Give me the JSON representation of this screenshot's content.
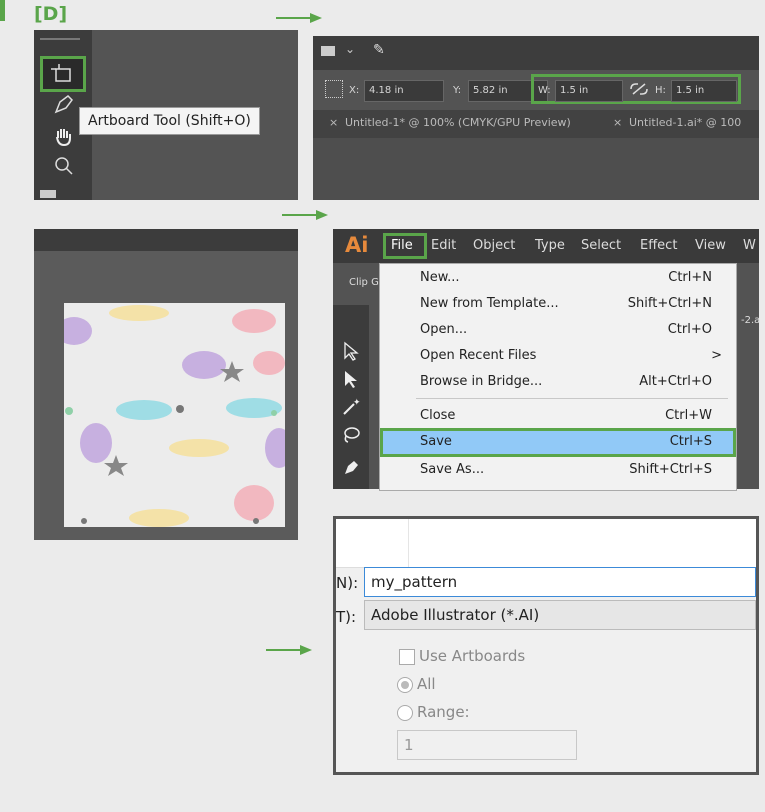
{
  "step_label": "[D]",
  "tooltip": "Artboard Tool (Shift+O)",
  "props": {
    "x_label": "X:",
    "x_value": "4.18 in",
    "y_label": "Y:",
    "y_value": "5.82 in",
    "w_label": "W:",
    "w_value": "1.5 in",
    "h_label": "H:",
    "h_value": "1.5 in"
  },
  "doc_tabs": {
    "tab1": "Untitled-1* @ 100% (CMYK/GPU Preview)",
    "close1": "×",
    "close2": "×",
    "tab2": "Untitled-1.ai* @ 100"
  },
  "menubar": {
    "logo": "Ai",
    "items": [
      "File",
      "Edit",
      "Object",
      "Type",
      "Select",
      "Effect",
      "View",
      "W"
    ],
    "left_label": "Clip G",
    "right_partial": "-2.a"
  },
  "file_menu": [
    {
      "label": "New...",
      "shortcut": "Ctrl+N"
    },
    {
      "label": "New from Template...",
      "shortcut": "Shift+Ctrl+N"
    },
    {
      "label": "Open...",
      "shortcut": "Ctrl+O"
    },
    {
      "label": "Open Recent Files",
      "shortcut": ">"
    },
    {
      "label": "Browse in Bridge...",
      "shortcut": "Alt+Ctrl+O"
    },
    {
      "label": "Close",
      "shortcut": "Ctrl+W"
    },
    {
      "label": "Save",
      "shortcut": "Ctrl+S"
    },
    {
      "label": "Save As...",
      "shortcut": "Shift+Ctrl+S"
    }
  ],
  "save_dialog": {
    "name_label": "N):",
    "name_value": "my_pattern",
    "type_label": "T):",
    "type_value": "Adobe Illustrator (*.AI)",
    "use_artboards": "Use Artboards",
    "all": "All",
    "range": "Range:",
    "range_value": "1"
  },
  "colors": {
    "accent": "#5aa54a",
    "menu_highlight": "#91c9f7"
  },
  "icons": [
    "artboard-tool-icon",
    "pen-tool-icon",
    "hand-tool-icon",
    "zoom-tool-icon",
    "unlink-icon",
    "arrow-icon"
  ]
}
